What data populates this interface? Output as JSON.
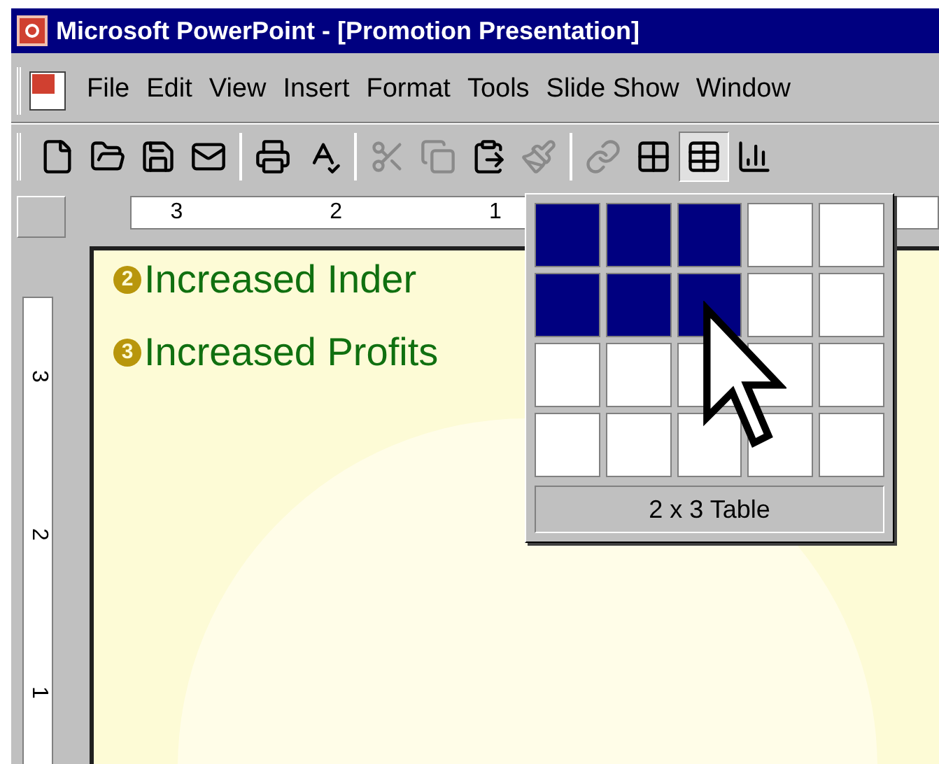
{
  "window": {
    "title": "Microsoft PowerPoint - [Promotion Presentation]"
  },
  "menu": [
    "File",
    "Edit",
    "View",
    "Insert",
    "Format",
    "Tools",
    "Slide Show",
    "Window"
  ],
  "toolbar": [
    {
      "kind": "new",
      "disabled": false,
      "pressed": false
    },
    {
      "kind": "open",
      "disabled": false,
      "pressed": false
    },
    {
      "kind": "save",
      "disabled": false,
      "pressed": false
    },
    {
      "kind": "mail",
      "disabled": false,
      "pressed": false
    },
    {
      "kind": "sep"
    },
    {
      "kind": "print",
      "disabled": false,
      "pressed": false
    },
    {
      "kind": "spelling",
      "disabled": false,
      "pressed": false
    },
    {
      "kind": "sep"
    },
    {
      "kind": "cut",
      "disabled": true,
      "pressed": false
    },
    {
      "kind": "copy",
      "disabled": true,
      "pressed": false
    },
    {
      "kind": "paste",
      "disabled": false,
      "pressed": false
    },
    {
      "kind": "painter",
      "disabled": true,
      "pressed": false
    },
    {
      "kind": "sep"
    },
    {
      "kind": "link",
      "disabled": true,
      "pressed": false
    },
    {
      "kind": "borders",
      "disabled": false,
      "pressed": false
    },
    {
      "kind": "table",
      "disabled": false,
      "pressed": true
    },
    {
      "kind": "chart",
      "disabled": false,
      "pressed": false
    }
  ],
  "ruler": {
    "horizontal": [
      "3",
      "2",
      "1"
    ],
    "vertical": [
      "3",
      "2",
      "1"
    ]
  },
  "slide": {
    "bullets": [
      {
        "number": "2",
        "text": "Increased Inder"
      },
      {
        "number": "3",
        "text": "Increased Profits"
      }
    ]
  },
  "table_picker": {
    "rows": [
      [
        true,
        true,
        true,
        false,
        false
      ],
      [
        true,
        true,
        true,
        false,
        false
      ],
      [
        false,
        false,
        false,
        false,
        false
      ],
      [
        false,
        false,
        false,
        false,
        false
      ]
    ],
    "label": "2 x 3 Table"
  }
}
